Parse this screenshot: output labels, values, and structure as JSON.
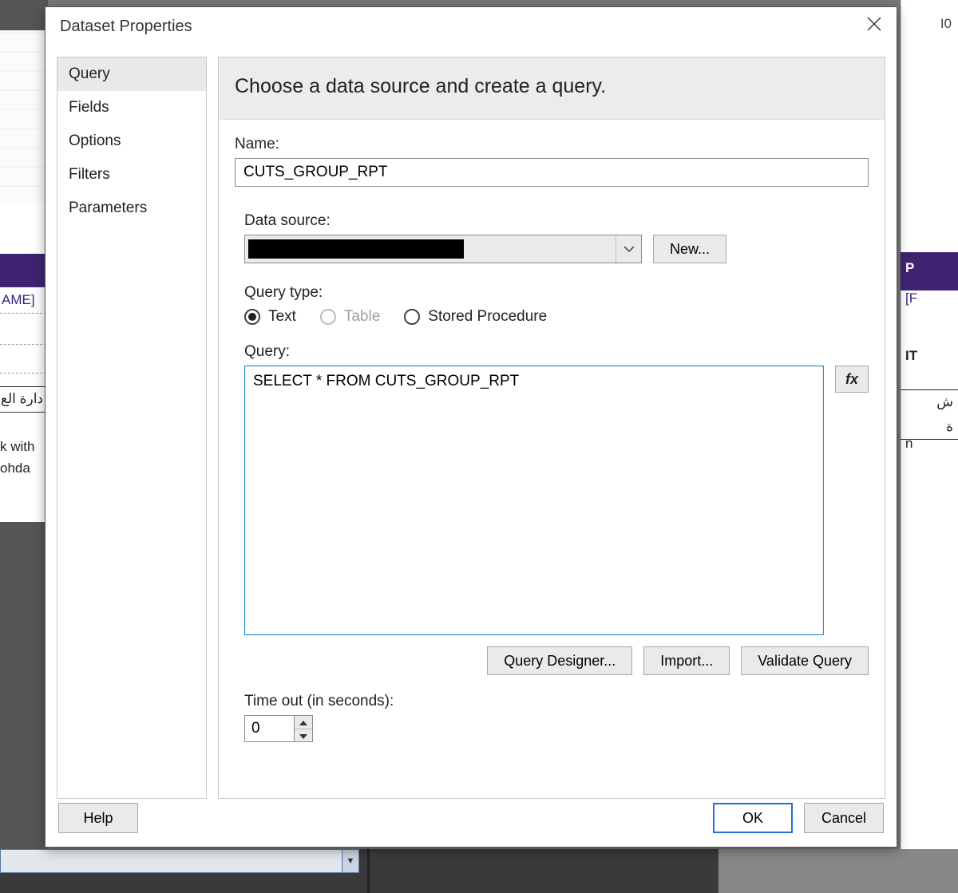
{
  "dialog": {
    "title": "Dataset Properties",
    "nav": {
      "items": [
        {
          "id": "query",
          "label": "Query",
          "selected": true
        },
        {
          "id": "fields",
          "label": "Fields",
          "selected": false
        },
        {
          "id": "options",
          "label": "Options",
          "selected": false
        },
        {
          "id": "filters",
          "label": "Filters",
          "selected": false
        },
        {
          "id": "parameters",
          "label": "Parameters",
          "selected": false
        }
      ]
    },
    "content": {
      "heading": "Choose a data source and create a query.",
      "name_label": "Name:",
      "name_value": "CUTS_GROUP_RPT",
      "datasource_label": "Data source:",
      "datasource_value": "",
      "new_button": "New...",
      "querytype_label": "Query type:",
      "query_types": [
        {
          "id": "text",
          "label": "Text",
          "selected": true,
          "enabled": true
        },
        {
          "id": "table",
          "label": "Table",
          "selected": false,
          "enabled": false
        },
        {
          "id": "sp",
          "label": "Stored Procedure",
          "selected": false,
          "enabled": true
        }
      ],
      "query_label": "Query:",
      "query_value": "SELECT * FROM CUTS_GROUP_RPT",
      "fx_label": "fx",
      "query_designer_button": "Query Designer...",
      "import_button": "Import...",
      "validate_button": "Validate Query",
      "timeout_label": "Time out (in seconds):",
      "timeout_value": "0"
    },
    "footer": {
      "help": "Help",
      "ok": "OK",
      "cancel": "Cancel"
    }
  },
  "background": {
    "ame": "AME]",
    "kwith": "k with",
    "ohda": "ohda",
    "arabic_left": "دارة الع",
    "r_io": "I0",
    "r_p": "P",
    "r_f": "[F",
    "r_it": "IT",
    "r_ar": "ش",
    "r_ar2": "ة",
    "r_n": "n"
  }
}
